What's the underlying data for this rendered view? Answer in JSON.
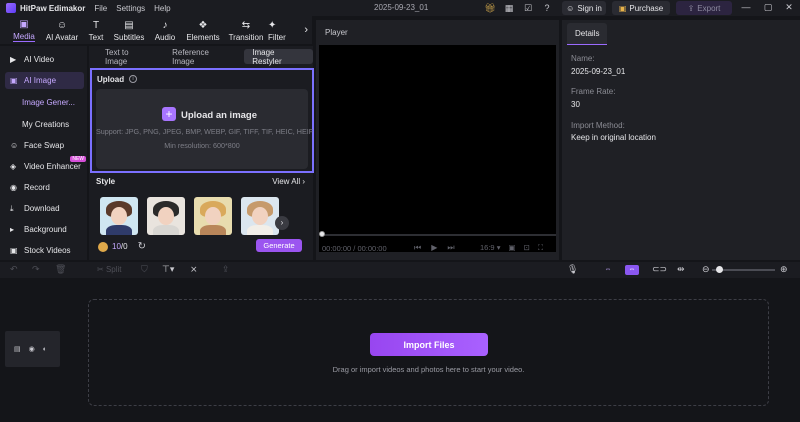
{
  "app": {
    "title": "HitPaw Edimakor",
    "menu": [
      "File",
      "Settings",
      "Help"
    ],
    "project_name": "2025-09-23_01",
    "sign_in": "Sign in",
    "purchase": "Purchase",
    "export": "Export"
  },
  "toolbar": {
    "tools": [
      {
        "label": "Media",
        "icon": "media-icon",
        "glyph": "▣"
      },
      {
        "label": "AI Avatar",
        "icon": "ai-avatar-icon",
        "glyph": "☺"
      },
      {
        "label": "Text",
        "icon": "text-icon",
        "glyph": "T"
      },
      {
        "label": "Subtitles",
        "icon": "subtitles-icon",
        "glyph": "▤"
      },
      {
        "label": "Audio",
        "icon": "audio-icon",
        "glyph": "♪"
      },
      {
        "label": "Elements",
        "icon": "elements-icon",
        "glyph": "❖"
      },
      {
        "label": "Transition",
        "icon": "transition-icon",
        "glyph": "⇆"
      },
      {
        "label": "Filter",
        "icon": "filter-icon",
        "glyph": "✦"
      }
    ],
    "active": "Media"
  },
  "leftnav": {
    "items": [
      {
        "label": "AI Video",
        "icon": "ai-video-icon",
        "glyph": "▶"
      },
      {
        "label": "AI Image",
        "icon": "ai-image-icon",
        "glyph": "▣"
      },
      {
        "label": "Face Swap",
        "icon": "face-swap-icon",
        "glyph": "☺"
      },
      {
        "label": "Video Enhancer",
        "icon": "video-enhancer-icon",
        "glyph": "◈",
        "badge": "NEW"
      },
      {
        "label": "Record",
        "icon": "record-icon",
        "glyph": "◉"
      },
      {
        "label": "Download",
        "icon": "download-icon",
        "glyph": "⤓"
      },
      {
        "label": "Background",
        "icon": "background-icon",
        "glyph": "▸"
      },
      {
        "label": "Stock Videos",
        "icon": "stock-videos-icon",
        "glyph": "▣"
      }
    ],
    "sub_items": [
      "Image Gener...",
      "My Creations"
    ]
  },
  "panel": {
    "tabs": [
      "Text to Image",
      "Reference Image",
      "Image Restyler"
    ],
    "active_tab": "Image Restyler",
    "upload_title": "Upload",
    "upload_cta": "Upload an image",
    "upload_support": "Support: JPG, PNG, JPEG, BMP, WEBP, GIF, TIFF, TIF, HEIC, HEIF",
    "upload_minres": "Min resolution: 600*800",
    "style_title": "Style",
    "view_all": "View All",
    "credits_used": "10",
    "credits_total": "/0",
    "generate": "Generate"
  },
  "player": {
    "title": "Player",
    "time": "00:00:00 / 00:00:00",
    "ratio": "16:9"
  },
  "details": {
    "tab": "Details",
    "fields": [
      {
        "label": "Name:",
        "value": "2025-09-23_01"
      },
      {
        "label": "Frame Rate:",
        "value": "30"
      },
      {
        "label": "Import Method:",
        "value": "Keep in original location"
      }
    ]
  },
  "timeline": {
    "split": "Split",
    "import_button": "Import Files",
    "drop_hint": "Drag or import videos and photos here to start your video."
  },
  "colors": {
    "accent": "#9b6bff",
    "highlight_border": "#7b70ff",
    "generate": "#9b55f0"
  }
}
